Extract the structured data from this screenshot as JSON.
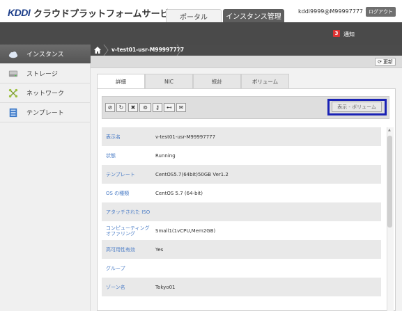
{
  "brand": {
    "logo": "KDDI",
    "title": "クラウドプラットフォームサービス"
  },
  "top_tabs": [
    {
      "label": "ポータル"
    },
    {
      "label": "インスタンス管理"
    }
  ],
  "user": {
    "label": "kddi9999@M99997777 さん",
    "logout": "ログアウト"
  },
  "notice": {
    "count": "3",
    "label": "通知"
  },
  "sidebar": {
    "items": [
      {
        "label": "インスタンス",
        "icon": "cloud-icon"
      },
      {
        "label": "ストレージ",
        "icon": "disk-icon"
      },
      {
        "label": "ネットワーク",
        "icon": "network-icon"
      },
      {
        "label": "テンプレート",
        "icon": "template-icon"
      }
    ]
  },
  "breadcrumb": {
    "item": "v-test01-usr-M99997777"
  },
  "refresh_label": "更新",
  "tabs": [
    {
      "label": "詳細"
    },
    {
      "label": "NIC"
    },
    {
      "label": "統計"
    },
    {
      "label": "ボリューム"
    }
  ],
  "toolbar": {
    "buttons": [
      {
        "icon": "stop-icon",
        "glyph": "⊘"
      },
      {
        "icon": "restart-icon",
        "glyph": "↻"
      },
      {
        "icon": "delete-icon",
        "glyph": "✖"
      },
      {
        "icon": "attach-iso-icon",
        "glyph": "⊚"
      },
      {
        "icon": "key-icon",
        "glyph": "⚷"
      },
      {
        "icon": "password-icon",
        "glyph": "⊷"
      },
      {
        "icon": "console-icon",
        "glyph": "✉"
      }
    ],
    "view_button": "表示 - ボリューム"
  },
  "details": [
    {
      "label": "表示名",
      "value": "v-test01-usr-M99997777"
    },
    {
      "label": "状態",
      "value": "Running"
    },
    {
      "label": "テンプレート",
      "value": "CentOS5.7(64bit)50GB Ver1.2"
    },
    {
      "label": "OS の種類",
      "value": "CentOS 5.7 (64-bit)"
    },
    {
      "label": "アタッチされた ISO",
      "value": ""
    },
    {
      "label": "コンピューティング オファリング",
      "value": "Small1(1vCPU,Mem2GB)"
    },
    {
      "label": "高可用性有効",
      "value": "Yes"
    },
    {
      "label": "グループ",
      "value": ""
    },
    {
      "label": "ゾーン名",
      "value": "Tokyo01"
    }
  ],
  "colors": {
    "accent": "#1a22b5",
    "brand": "#1d3f8a",
    "label_blue": "#4a7cc6"
  }
}
